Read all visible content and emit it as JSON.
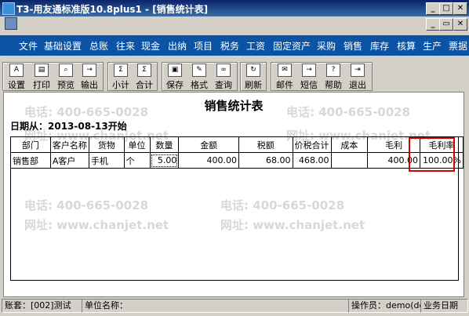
{
  "window": {
    "title": "T3-用友通标准版10.8plus1 - [销售统计表]"
  },
  "menu": {
    "items": [
      "文件",
      "基础设置",
      "总账",
      "往来",
      "现金",
      "出纳",
      "项目",
      "税务",
      "工资",
      "固定资产",
      "采购",
      "销售",
      "库存",
      "核算",
      "生产",
      "票据"
    ]
  },
  "toolbar": {
    "buttons": [
      "设置",
      "打印",
      "预览",
      "输出",
      "小计",
      "合计",
      "保存",
      "格式",
      "查询",
      "刷新",
      "邮件",
      "短信",
      "帮助",
      "退出"
    ]
  },
  "watermark": {
    "phone": "电话: 400-665-0028",
    "site": "网址: www.chanjet.net"
  },
  "report": {
    "title": "销售统计表",
    "date_line": "日期从：2013-08-13开始",
    "columns": [
      "部门",
      "客户名称",
      "货物",
      "单位",
      "数量",
      "金额",
      "税额",
      "价税合计",
      "成本",
      "毛利",
      "毛利率"
    ],
    "rows": [
      [
        "销售部",
        "A客户",
        "手机",
        "个",
        "5.00",
        "400.00",
        "68.00",
        "468.00",
        "",
        "400.00",
        "100.00%"
      ]
    ]
  },
  "status": {
    "account": "账套：[002]测试",
    "unit": "单位名称：",
    "operator": "操作员：demo(de",
    "date": "业务日期"
  }
}
